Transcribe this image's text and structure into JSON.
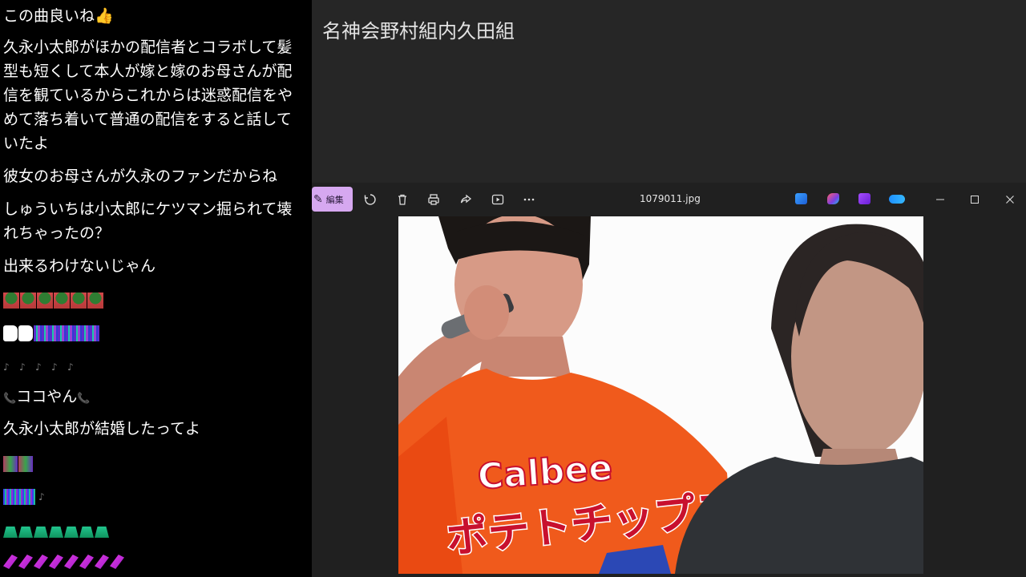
{
  "chat": {
    "messages": [
      {
        "text": "この曲良いね👍"
      },
      {
        "text": "久永小太郎がほかの配信者とコラボして髪型も短くして本人が嫁と嫁のお母さんが配信を観ているからこれからは迷惑配信をやめて落ち着いて普通の配信をすると話していたよ"
      },
      {
        "text": "彼女のお母さんが久永のファンだからね"
      },
      {
        "text": "しゅういちは小太郎にケツマン掘られて壊れちゃったの？"
      },
      {
        "text": "出来るわけないじゃん"
      },
      {
        "text": "ココやん"
      },
      {
        "text": "久永小太郎が結婚したってよ"
      }
    ]
  },
  "stream": {
    "title": "名神会野村組内久田組"
  },
  "viewer": {
    "edit_label": "編集",
    "filename": "1079011.jpg",
    "toolbar_icons": [
      "rotate-icon",
      "delete-icon",
      "print-icon",
      "share-icon",
      "slideshow-icon",
      "more-icon"
    ],
    "app_icons": [
      "designer-icon",
      "clipchamp-icon",
      "copilot-icon",
      "onedrive-icon"
    ],
    "window_controls": [
      "minimize-icon",
      "maximize-icon",
      "close-icon"
    ]
  },
  "photo": {
    "shirt_brand": "Calbee",
    "shirt_product": "ポテトチップス"
  },
  "colors": {
    "edit_button": "#d6a8f0",
    "viewer_bg": "#202020",
    "shirt": "#f05a1c",
    "brand_red": "#c8102e"
  }
}
